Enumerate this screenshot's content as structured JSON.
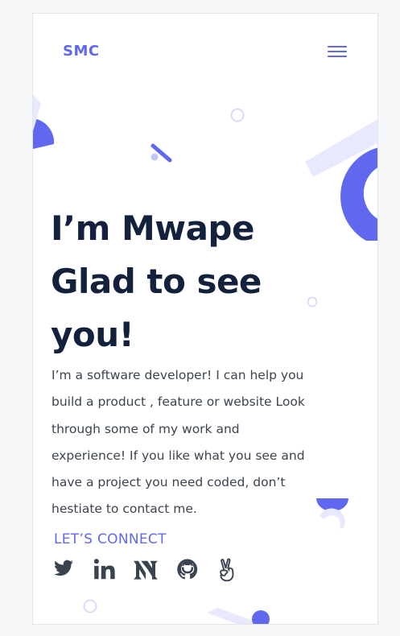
{
  "header": {
    "logo": "SMC",
    "menu_icon": "hamburger-menu-icon"
  },
  "hero": {
    "title_lines": [
      "I’m Mwape",
      "Glad to see",
      "you!"
    ],
    "intro_lines": [
      "I’m a software developer! I can help you",
      "build a product , feature or website Look",
      "through some of my work and",
      "experience! If you like what you see and",
      "have a project you need coded, don’t",
      "hestiate to contact me."
    ]
  },
  "connect": {
    "label": "LET’S CONNECT",
    "socials": [
      {
        "name": "Twitter",
        "icon": "twitter-icon"
      },
      {
        "name": "LinkedIn",
        "icon": "linkedin-icon"
      },
      {
        "name": "Medium",
        "icon": "medium-icon"
      },
      {
        "name": "GitHub",
        "icon": "github-icon"
      },
      {
        "name": "AngelList",
        "icon": "angellist-icon"
      }
    ]
  },
  "colors": {
    "accent": "#6068f0",
    "accent_light": "#e8e9fd",
    "heading": "#14213d",
    "body_text": "#3c4451",
    "icon": "#3a4450",
    "background": "#ffffff",
    "page_background": "#f6f7f8"
  }
}
